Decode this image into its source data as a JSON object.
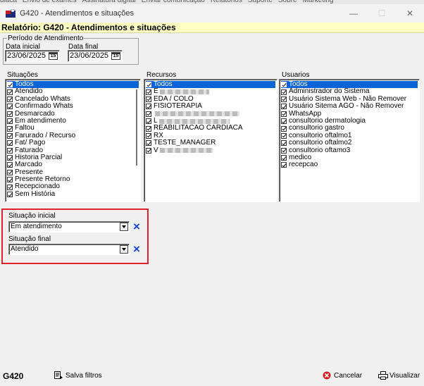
{
  "background_menu": [
    "diaca",
    "Envio de exames",
    "Assinatura digital",
    "Enviar comunicação",
    "Relatórios",
    "Suporte",
    "Sobre",
    "Marketing"
  ],
  "window": {
    "title": "G420 - Atendimentos e situações",
    "minimize": "—",
    "maximize": "☐",
    "close": "✕"
  },
  "report_header": "Relatório: G420 - Atendimentos e situações",
  "period": {
    "legend": "Período de Atendimento",
    "start_label": "Data inicial",
    "start_value": "23/06/2025",
    "end_label": "Data final",
    "end_value": "23/06/2025",
    "calendar_icon_text": "15"
  },
  "situacoes": {
    "label": "Situações",
    "items": [
      "Todos",
      "Atendido",
      "Cancelado Whats",
      "Confirmado Whats",
      "Desmarcado",
      "Em atendimento",
      "Faltou",
      "Farurado / Recurso",
      "Fat/ Pago",
      "Faturado",
      "Historia Parcial",
      "Marcado",
      "Presente",
      "Presente Retorno",
      "Recepcionado",
      "Sem História"
    ]
  },
  "recursos": {
    "label": "Recursos",
    "items": [
      {
        "text": "Todos",
        "blur": 0
      },
      {
        "text": "E",
        "blur": 70
      },
      {
        "text": "EDA / COLO",
        "blur": 0
      },
      {
        "text": "FISIOTERAPIA",
        "blur": 0
      },
      {
        "text": "",
        "blur": 120
      },
      {
        "text": "L",
        "blur": 100
      },
      {
        "text": "REABILITACAO CARDIACA",
        "blur": 0
      },
      {
        "text": "RX",
        "blur": 0
      },
      {
        "text": "TESTE_MANAGER",
        "blur": 0
      },
      {
        "text": "V",
        "blur": 75
      }
    ]
  },
  "usuarios": {
    "label": "Usuarios",
    "items": [
      "Todos",
      "Administrador do Sistema",
      "Usuário Sistema Web - Não Remover",
      "Usuário Sitema AGO - Não Remover",
      "WhatsApp",
      "consultorio dermatologia",
      "consultorio gastro",
      "consultorio oftalmo1",
      "consultorio oftalmo2",
      "consultorio oftamo3",
      "medico",
      "recepcao"
    ]
  },
  "situacao_inicial": {
    "label": "Situação inicial",
    "value": "Em atendimento"
  },
  "situacao_final": {
    "label": "Situação final",
    "value": "Atendido"
  },
  "footer": {
    "code": "G420",
    "save_filters": "Salva filtros",
    "cancel": "Cancelar",
    "view": "Visualizar"
  },
  "colors": {
    "highlight": "#e0222c",
    "selection": "#0a64d8",
    "header_bg": "#ffffc4",
    "clear_icon": "#1a3fd6"
  }
}
